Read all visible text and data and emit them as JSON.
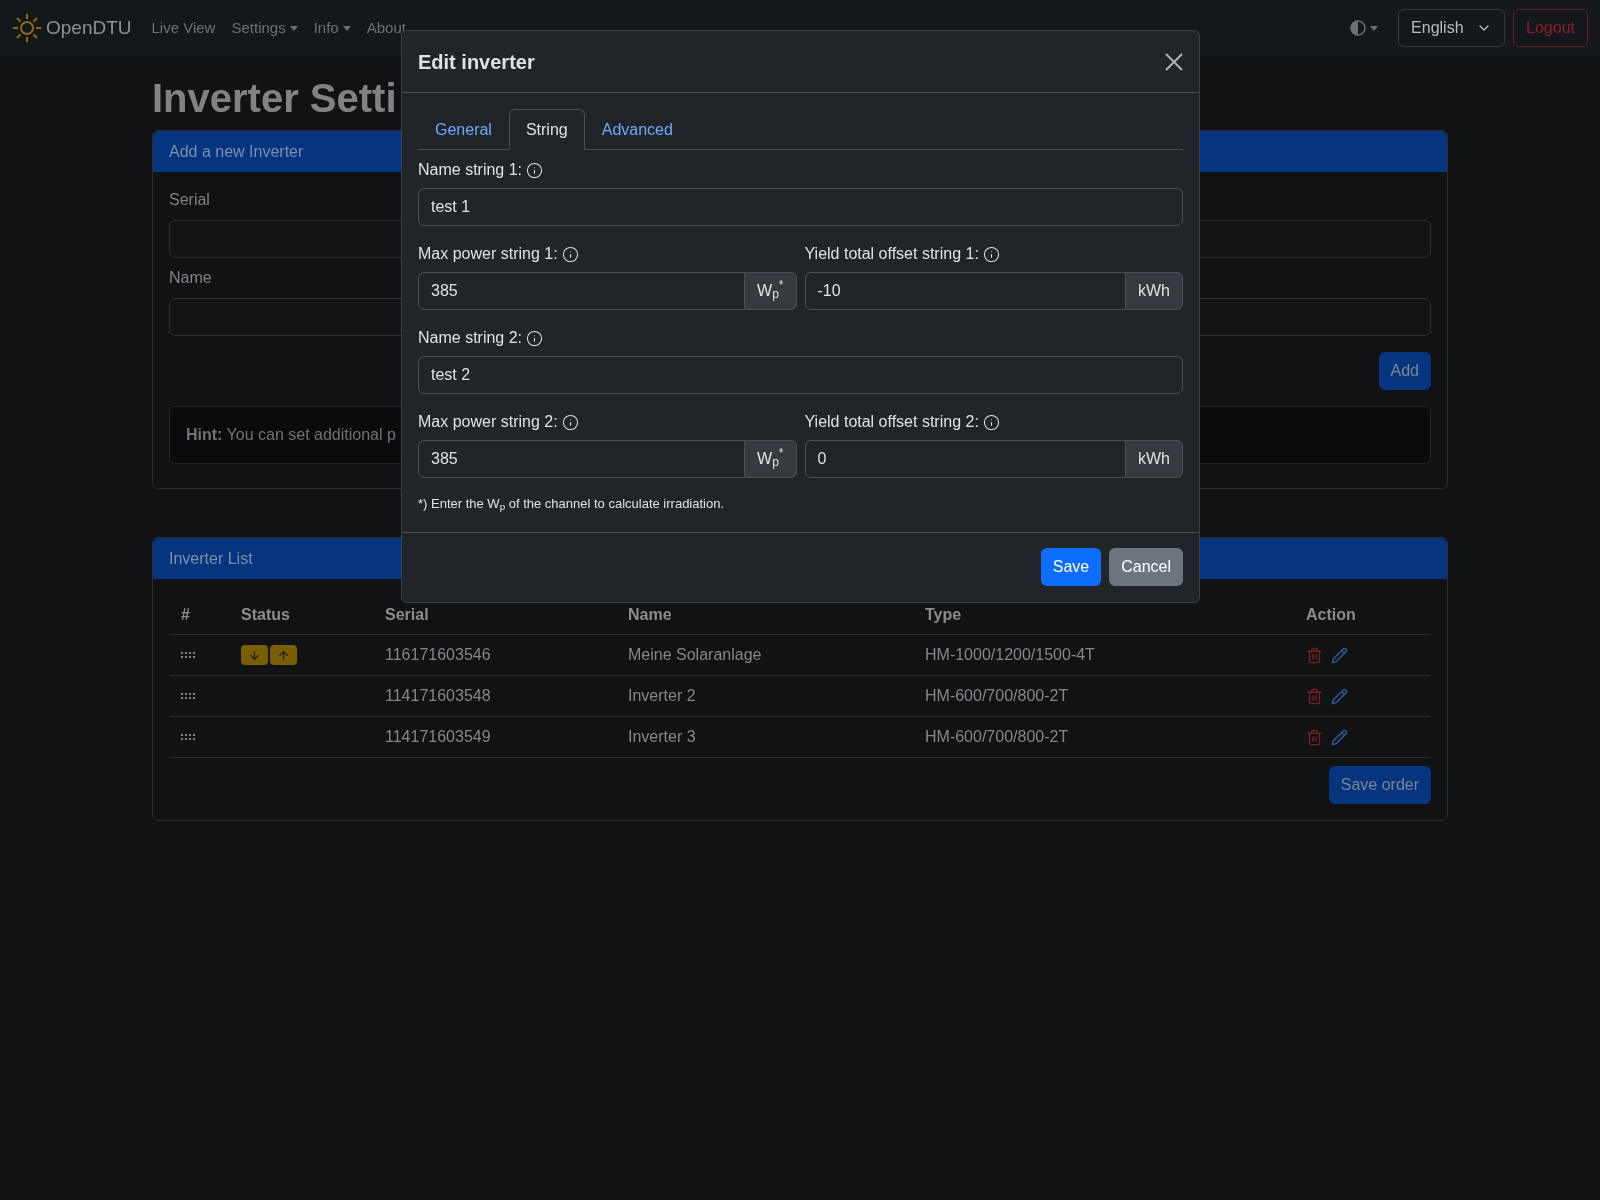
{
  "navbar": {
    "brand": "OpenDTU",
    "items": [
      {
        "label": "Live View",
        "dropdown": false
      },
      {
        "label": "Settings",
        "dropdown": true
      },
      {
        "label": "Info",
        "dropdown": true
      },
      {
        "label": "About",
        "dropdown": false
      }
    ],
    "language": "English",
    "logout": "Logout"
  },
  "page": {
    "title": "Inverter Setti"
  },
  "add_card": {
    "header": "Add a new Inverter",
    "fields": [
      {
        "label": "Serial"
      },
      {
        "label": "Name"
      }
    ],
    "add_button": "Add",
    "hint": "**Hint:** You can set additional p"
  },
  "list_card": {
    "header": "Inverter List",
    "columns": [
      "#",
      "Status",
      "Serial",
      "Name",
      "Type",
      "Action"
    ],
    "rows": [
      {
        "reachable": true,
        "serial": "116171603546",
        "name": "Meine Solaranlage",
        "type": "HM-1000/1200/1500-4T"
      },
      {
        "reachable": false,
        "serial": "114171603548",
        "name": "Inverter 2",
        "type": "HM-600/700/800-2T"
      },
      {
        "reachable": false,
        "serial": "114171603549",
        "name": "Inverter 3",
        "type": "HM-600/700/800-2T"
      }
    ],
    "save_order": "Save order"
  },
  "modal": {
    "title": "Edit inverter",
    "tabs": [
      {
        "label": "General",
        "selected": false
      },
      {
        "label": "String",
        "selected": true
      },
      {
        "label": "Advanced",
        "selected": false
      }
    ],
    "strings": [
      {
        "name_label": "Name string 1:",
        "name_value": "test 1",
        "power_label": "Max power string 1:",
        "power_value": "385",
        "power_unit": "W$_{p}$$^{*}$",
        "offset_label": "Yield total offset string 1:",
        "offset_value": "-10",
        "offset_unit": "kWh"
      },
      {
        "name_label": "Name string 2:",
        "name_value": "test 2",
        "power_label": "Max power string 2:",
        "power_value": "385",
        "power_unit": "W$_{p}$$^{*}$",
        "offset_label": "Yield total offset string 2:",
        "offset_value": "0",
        "offset_unit": "kWh"
      }
    ],
    "footnote": "*) Enter the W$_{p}$ of the channel to calculate irradiation.",
    "save": "Save",
    "cancel": "Cancel"
  }
}
